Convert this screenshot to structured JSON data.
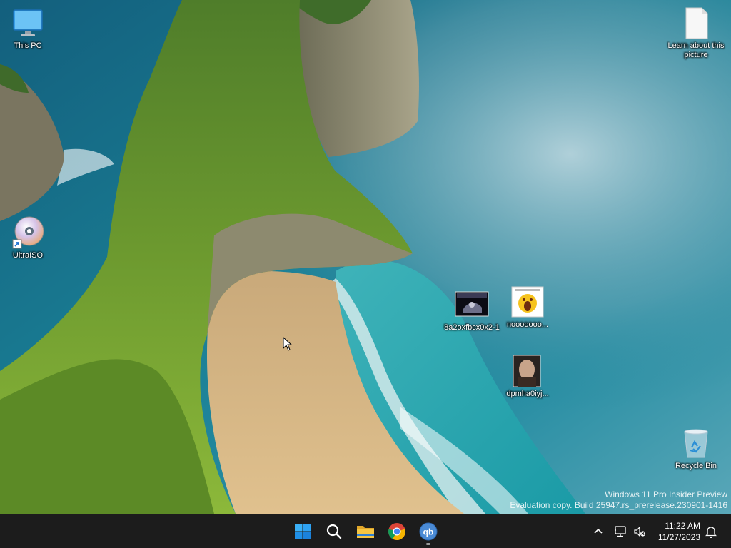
{
  "desktop": {
    "icons": [
      {
        "label": "This PC",
        "icon": "monitor-icon"
      },
      {
        "label": "Learn about this picture",
        "icon": "document-icon"
      },
      {
        "label": "UltraISO",
        "icon": "disc-icon"
      },
      {
        "label": "8a2oxfbcx0x2-1",
        "icon": "video-thumbnail-icon"
      },
      {
        "label": "nooooooo...",
        "icon": "image-thumbnail-icon"
      },
      {
        "label": "dpmha0iyj...",
        "icon": "image-thumbnail-icon"
      },
      {
        "label": "Recycle Bin",
        "icon": "recycle-bin-icon"
      }
    ]
  },
  "watermark": {
    "line1": "Windows 11 Pro Insider Preview",
    "line2": "Evaluation copy. Build 25947.rs_prerelease.230901-1416"
  },
  "taskbar": {
    "apps": [
      {
        "name": "Start",
        "icon": "windows-logo-icon"
      },
      {
        "name": "Search",
        "icon": "search-icon"
      },
      {
        "name": "File Explorer",
        "icon": "folder-icon"
      },
      {
        "name": "Google Chrome",
        "icon": "chrome-icon"
      },
      {
        "name": "qBittorrent",
        "icon": "qbittorrent-icon",
        "glyph_text": "qb"
      }
    ],
    "tray": {
      "chevron": "chevron-up-icon",
      "network": "network-icon",
      "volume": "volume-muted-icon",
      "time": "11:22 AM",
      "date": "11/27/2023",
      "notifications": "bell-icon"
    }
  },
  "colors": {
    "taskbar_bg": "#1c1c1c",
    "windows_blue": "#0078d4",
    "qbittorrent_blue": "#4a8ad4",
    "folder_yellow": "#f5c542"
  }
}
